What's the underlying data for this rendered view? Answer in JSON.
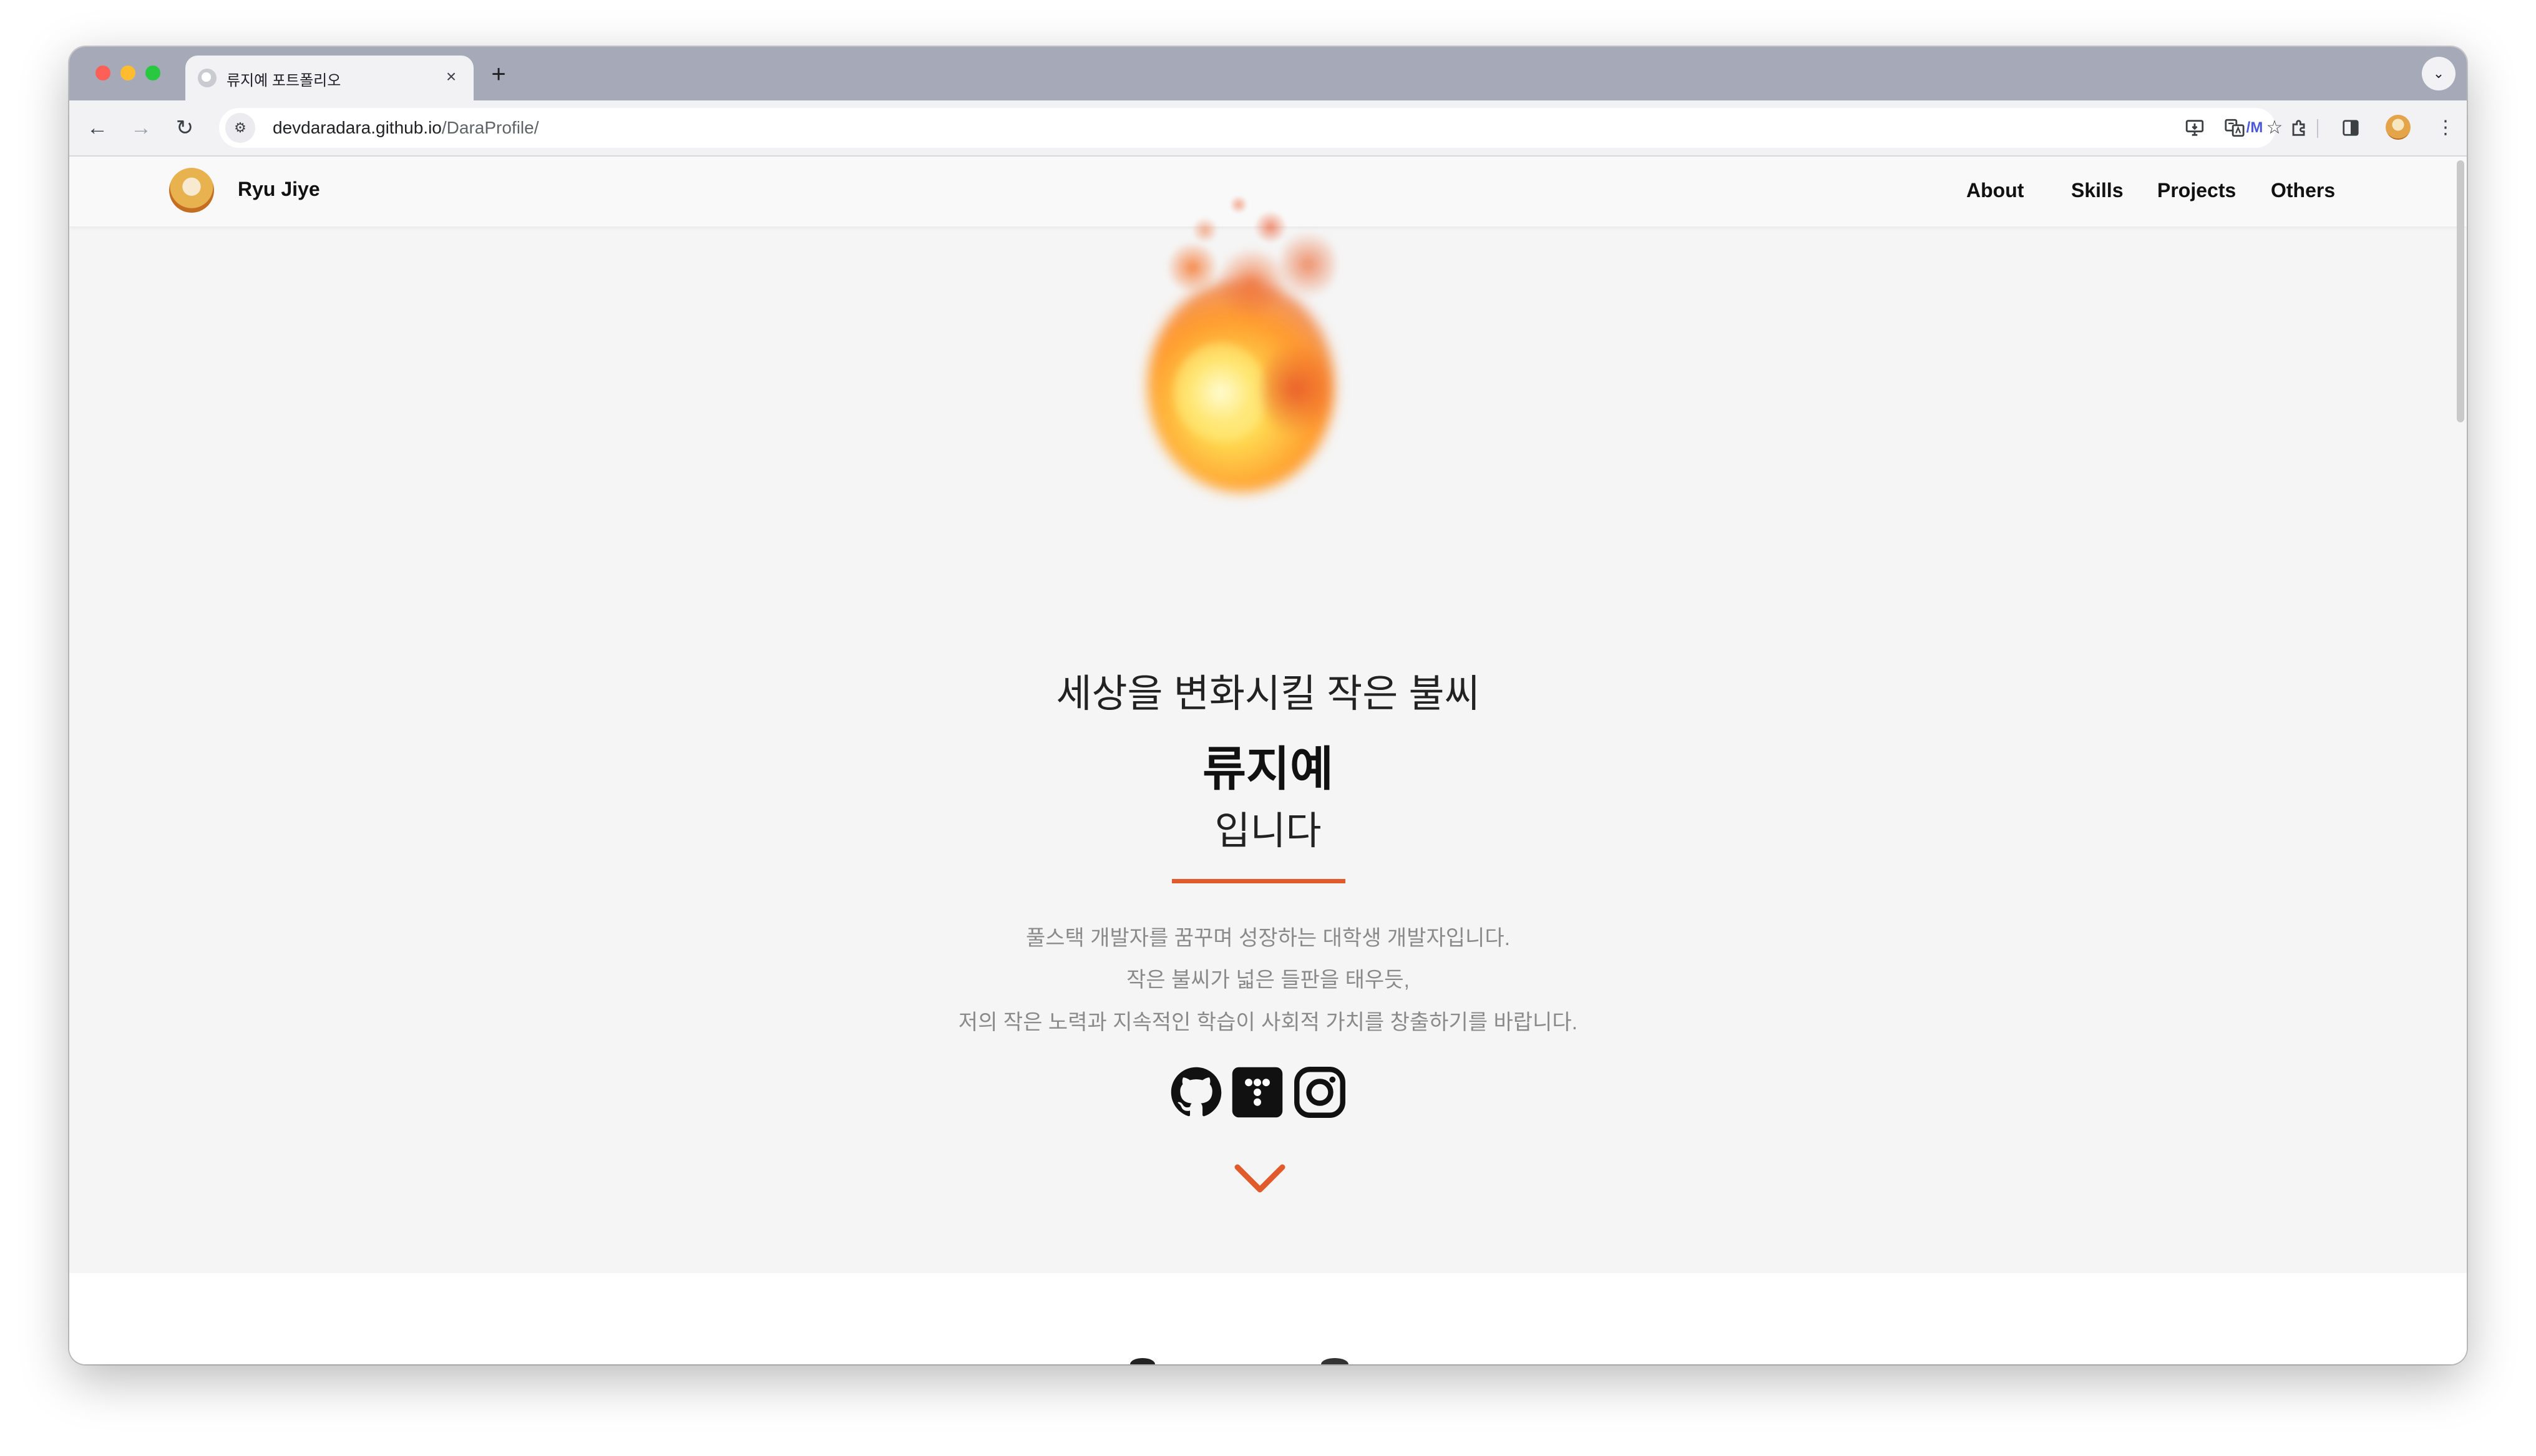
{
  "browser": {
    "tab": {
      "title": "류지예 포트폴리오",
      "close": "×"
    },
    "new_tab": "+",
    "tab_search": "⌄",
    "nav": {
      "back": "←",
      "forward": "→",
      "reload": "↻"
    },
    "address": {
      "host": "devdaradara.github.io",
      "path": "/DaraProfile/"
    }
  },
  "site": {
    "name": "Ryu Jiye",
    "nav": [
      "About",
      "Skills",
      "Projects",
      "Others"
    ]
  },
  "hero": {
    "line1": "세상을 변화시킬 작은 불씨",
    "name": "류지예",
    "line3": "입니다",
    "intro": [
      "풀스택 개발자를 꿈꾸며 성장하는 대학생 개발자입니다.",
      "작은 불씨가 넓은 들판을 태우듯,",
      "저의 작은 노력과 지속적인 학습이 사회적 가치를 창출하기를 바랍니다."
    ],
    "social_icons": [
      "github-icon",
      "tistory-icon",
      "instagram-icon"
    ]
  },
  "colors": {
    "accent": "#e05a2b",
    "hero_bg": "#f5f5f5",
    "tab_strip": "#a5a9b8"
  }
}
